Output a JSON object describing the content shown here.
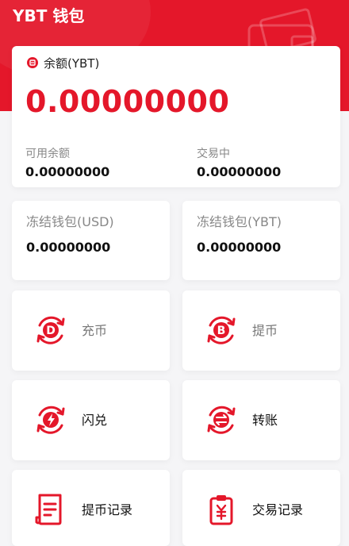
{
  "header": {
    "title": "YBT 钱包"
  },
  "balance": {
    "label": "余额(YBT)",
    "amount": "0.00000000",
    "available_label": "可用余额",
    "available_value": "0.00000000",
    "trading_label": "交易中",
    "trading_value": "0.00000000"
  },
  "frozen": [
    {
      "label": "冻结钱包(USD)",
      "value": "0.00000000"
    },
    {
      "label": "冻结钱包(YBT)",
      "value": "0.00000000"
    }
  ],
  "actions": [
    {
      "label": "充币",
      "icon": "deposit-icon"
    },
    {
      "label": "提币",
      "icon": "withdraw-icon"
    },
    {
      "label": "闪兑",
      "icon": "flash-exchange-icon"
    },
    {
      "label": "转账",
      "icon": "transfer-icon"
    },
    {
      "label": "提币记录",
      "icon": "withdraw-record-icon"
    },
    {
      "label": "交易记录",
      "icon": "trade-record-icon"
    }
  ],
  "colors": {
    "brand": "#e4172a",
    "background": "#f5f5f7"
  }
}
